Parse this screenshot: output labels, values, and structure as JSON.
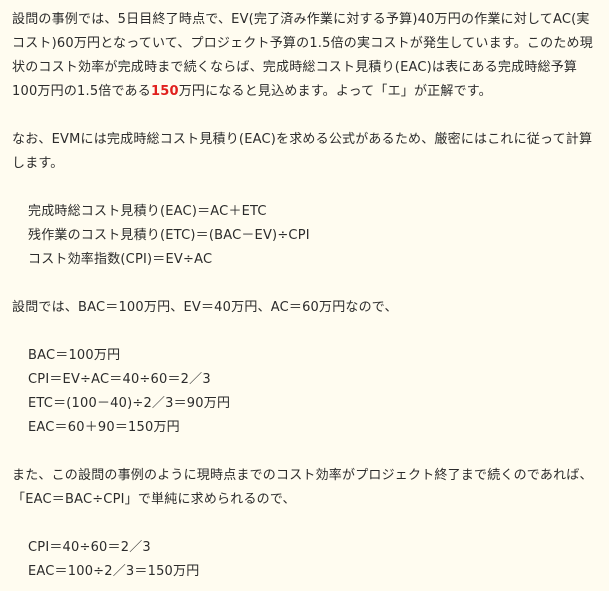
{
  "explanation": {
    "p1_part1": "設問の事例では、5日目終了時点で、EV(完了済み作業に対する予算)40万円の作業に対してAC(実コスト)60万円となっていて、プロジェクト予算の1.5倍の実コストが発生しています。このため現状のコスト効率が完成時まで続くならば、完成時総コスト見積り(EAC)は表にある完成時総予算100万円の1.5倍である",
    "p1_highlight": "150",
    "p1_part2": "万円になると見込めます。よって「エ」が正解です。",
    "p2": "なお、EVMには完成時総コスト見積り(EAC)を求める公式があるため、厳密にはこれに従って計算します。",
    "formulas": [
      "完成時総コスト見積り(EAC)＝AC＋ETC",
      "残作業のコスト見積り(ETC)＝(BAC－EV)÷CPI",
      "コスト効率指数(CPI)＝EV÷AC"
    ],
    "p3": "設問では、BAC＝100万円、EV＝40万円、AC＝60万円なので、",
    "calc1": [
      "BAC＝100万円",
      "CPI＝EV÷AC＝40÷60＝2／3",
      "ETC＝(100－40)÷2／3＝90万円",
      "EAC＝60＋90＝150万円"
    ],
    "p4": "また、この設問の事例のように現時点までのコスト効率がプロジェクト終了まで続くのであれば、「EAC＝BAC÷CPI」で単純に求められるので、",
    "calc2": [
      "CPI＝40÷60＝2／3",
      "EAC＝100÷2／3＝150万円"
    ]
  }
}
